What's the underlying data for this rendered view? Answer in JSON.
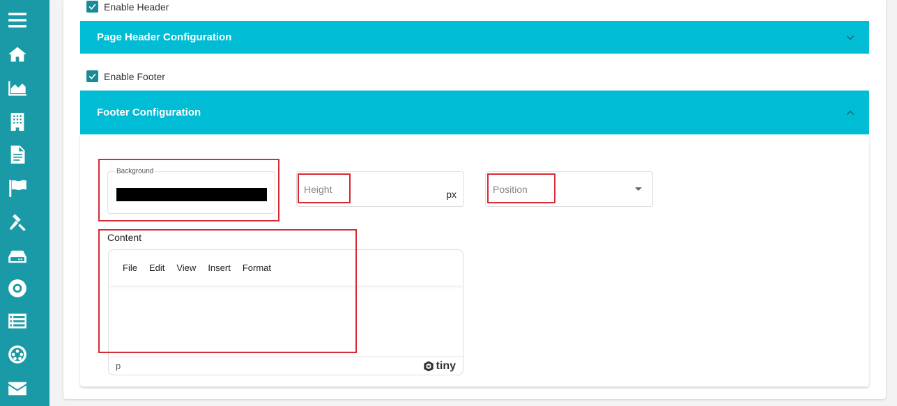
{
  "sidebar": {
    "icons": [
      "menu-icon",
      "home-icon",
      "chart-area-icon",
      "building-icon",
      "document-icon",
      "flag-icon",
      "gavel-icon",
      "inbox-icon",
      "lifebuoy-icon",
      "list-icon",
      "settings-icon",
      "mail-icon"
    ]
  },
  "header_section": {
    "enable_label": "Enable Header",
    "enabled": true,
    "title": "Page Header Configuration",
    "expanded": false
  },
  "footer_section": {
    "enable_label": "Enable Footer",
    "enabled": true,
    "title": "Footer Configuration",
    "expanded": true,
    "background": {
      "label": "Background",
      "value": "#000000"
    },
    "height": {
      "placeholder": "Height",
      "unit": "px"
    },
    "position": {
      "placeholder": "Position"
    },
    "content": {
      "label": "Content",
      "menu": [
        "File",
        "Edit",
        "View",
        "Insert",
        "Format"
      ],
      "status_path": "p",
      "brand": "tiny"
    }
  },
  "colors": {
    "sidebar": "#1a9aa6",
    "accordion": "#00bcd4",
    "highlight": "#d62a34"
  }
}
